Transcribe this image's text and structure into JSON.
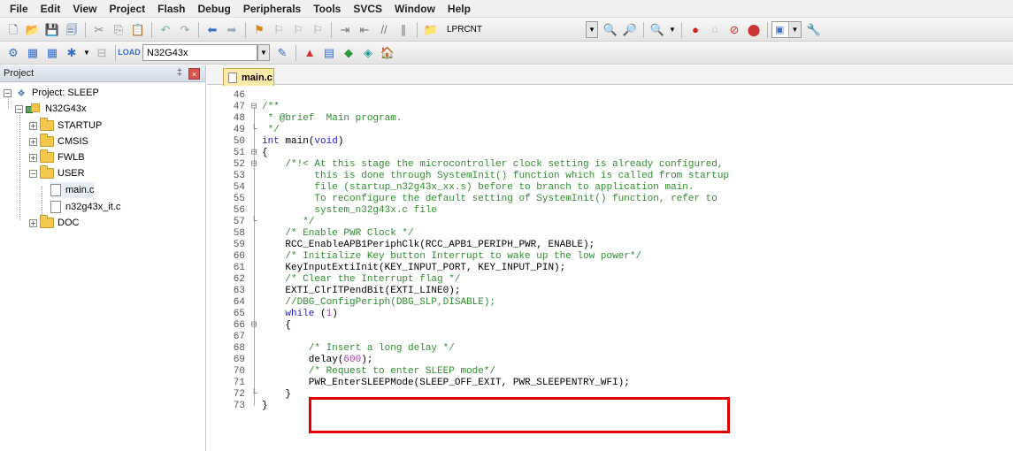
{
  "menu": [
    "File",
    "Edit",
    "View",
    "Project",
    "Flash",
    "Debug",
    "Peripherals",
    "Tools",
    "SVCS",
    "Window",
    "Help"
  ],
  "toolbar1": {
    "search_combo": "LPRCNT",
    "icons": [
      "new-file-icon",
      "open-folder-icon",
      "save-icon",
      "save-all-icon",
      "cut-icon",
      "copy-icon",
      "paste-icon",
      "undo-icon",
      "redo-icon",
      "nav-back-icon",
      "nav-forward-icon",
      "bookmark-icon",
      "prev-bookmark-icon",
      "next-bookmark-icon",
      "clear-bookmarks-icon",
      "indent-icon",
      "unindent-icon",
      "comment-icon",
      "uncomment-icon",
      "find-in-files-icon",
      "find-icon",
      "incremental-find-icon",
      "debug-icon",
      "breakpoint-icon",
      "disable-breakpoint-icon",
      "kill-breakpoints-icon",
      "clear-breakpoints-icon",
      "window-layout-icon",
      "configure-icon"
    ]
  },
  "toolbar2": {
    "target_combo": "N32G43x",
    "icons": [
      "translate-icon",
      "build-icon",
      "rebuild-icon",
      "batch-build-icon",
      "stop-build-icon",
      "download-icon",
      "target-options-icon",
      "manage-components-icon",
      "select-packs-icon",
      "pack-installer-icon",
      "run-time-env-icon"
    ]
  },
  "project_panel": {
    "title": "Project",
    "pin_glyph": "‡",
    "close_glyph": "×",
    "tree": {
      "project": "Project: SLEEP",
      "target": "N32G43x",
      "groups": [
        "STARTUP",
        "CMSIS",
        "FWLB",
        "USER",
        "DOC"
      ],
      "user_files": [
        "main.c",
        "n32g43x_it.c"
      ]
    }
  },
  "editor": {
    "active_tab": "main.c",
    "lines": [
      {
        "n": "46",
        "fold": "",
        "text": ""
      },
      {
        "n": "47",
        "fold": "⊟",
        "text": "/**"
      },
      {
        "n": "48",
        "fold": "",
        "text": " * @brief  Main program."
      },
      {
        "n": "49",
        "fold": "└",
        "text": " */"
      },
      {
        "n": "50",
        "fold": "",
        "text": "int main(void)"
      },
      {
        "n": "51",
        "fold": "⊟",
        "text": "{"
      },
      {
        "n": "52",
        "fold": "⊟",
        "text": "    /*!< At this stage the microcontroller clock setting is already configured,"
      },
      {
        "n": "53",
        "fold": "",
        "text": "         this is done through SystemInit() function which is called from startup"
      },
      {
        "n": "54",
        "fold": "",
        "text": "         file (startup_n32g43x_xx.s) before to branch to application main."
      },
      {
        "n": "55",
        "fold": "",
        "text": "         To reconfigure the default setting of SystemInit() function, refer to"
      },
      {
        "n": "56",
        "fold": "",
        "text": "         system_n32g43x.c file"
      },
      {
        "n": "57",
        "fold": "└",
        "text": "       */"
      },
      {
        "n": "58",
        "fold": "",
        "text": "    /* Enable PWR Clock */"
      },
      {
        "n": "59",
        "fold": "",
        "text": "    RCC_EnableAPB1PeriphClk(RCC_APB1_PERIPH_PWR, ENABLE);"
      },
      {
        "n": "60",
        "fold": "",
        "text": "    /* Initialize Key button Interrupt to wake up the low power*/"
      },
      {
        "n": "61",
        "fold": "",
        "text": "    KeyInputExtiInit(KEY_INPUT_PORT, KEY_INPUT_PIN);"
      },
      {
        "n": "62",
        "fold": "",
        "text": "    /* Clear the Interrupt flag */"
      },
      {
        "n": "63",
        "fold": "",
        "text": "    EXTI_ClrITPendBit(EXTI_LINE0);"
      },
      {
        "n": "64",
        "fold": "",
        "text": "    //DBG_ConfigPeriph(DBG_SLP,DISABLE);"
      },
      {
        "n": "65",
        "fold": "",
        "text": "    while (1)"
      },
      {
        "n": "66",
        "fold": "⊟",
        "text": "    {"
      },
      {
        "n": "67",
        "fold": "",
        "text": ""
      },
      {
        "n": "68",
        "fold": "",
        "text": "        /* Insert a long delay */"
      },
      {
        "n": "69",
        "fold": "",
        "text": "        delay(600);"
      },
      {
        "n": "70",
        "fold": "",
        "text": "        /* Request to enter SLEEP mode*/"
      },
      {
        "n": "71",
        "fold": "",
        "text": "        PWR_EnterSLEEPMode(SLEEP_OFF_EXIT, PWR_SLEEPENTRY_WFI);"
      },
      {
        "n": "72",
        "fold": "└",
        "text": "    }"
      },
      {
        "n": "73",
        "fold": "",
        "text": "}"
      }
    ]
  },
  "colors": {
    "comment": "#2e8b2e",
    "keyword": "#2222d4",
    "number": "#a23ea2",
    "highlight_box": "#e00000",
    "tab_active": "#fde9a8"
  }
}
